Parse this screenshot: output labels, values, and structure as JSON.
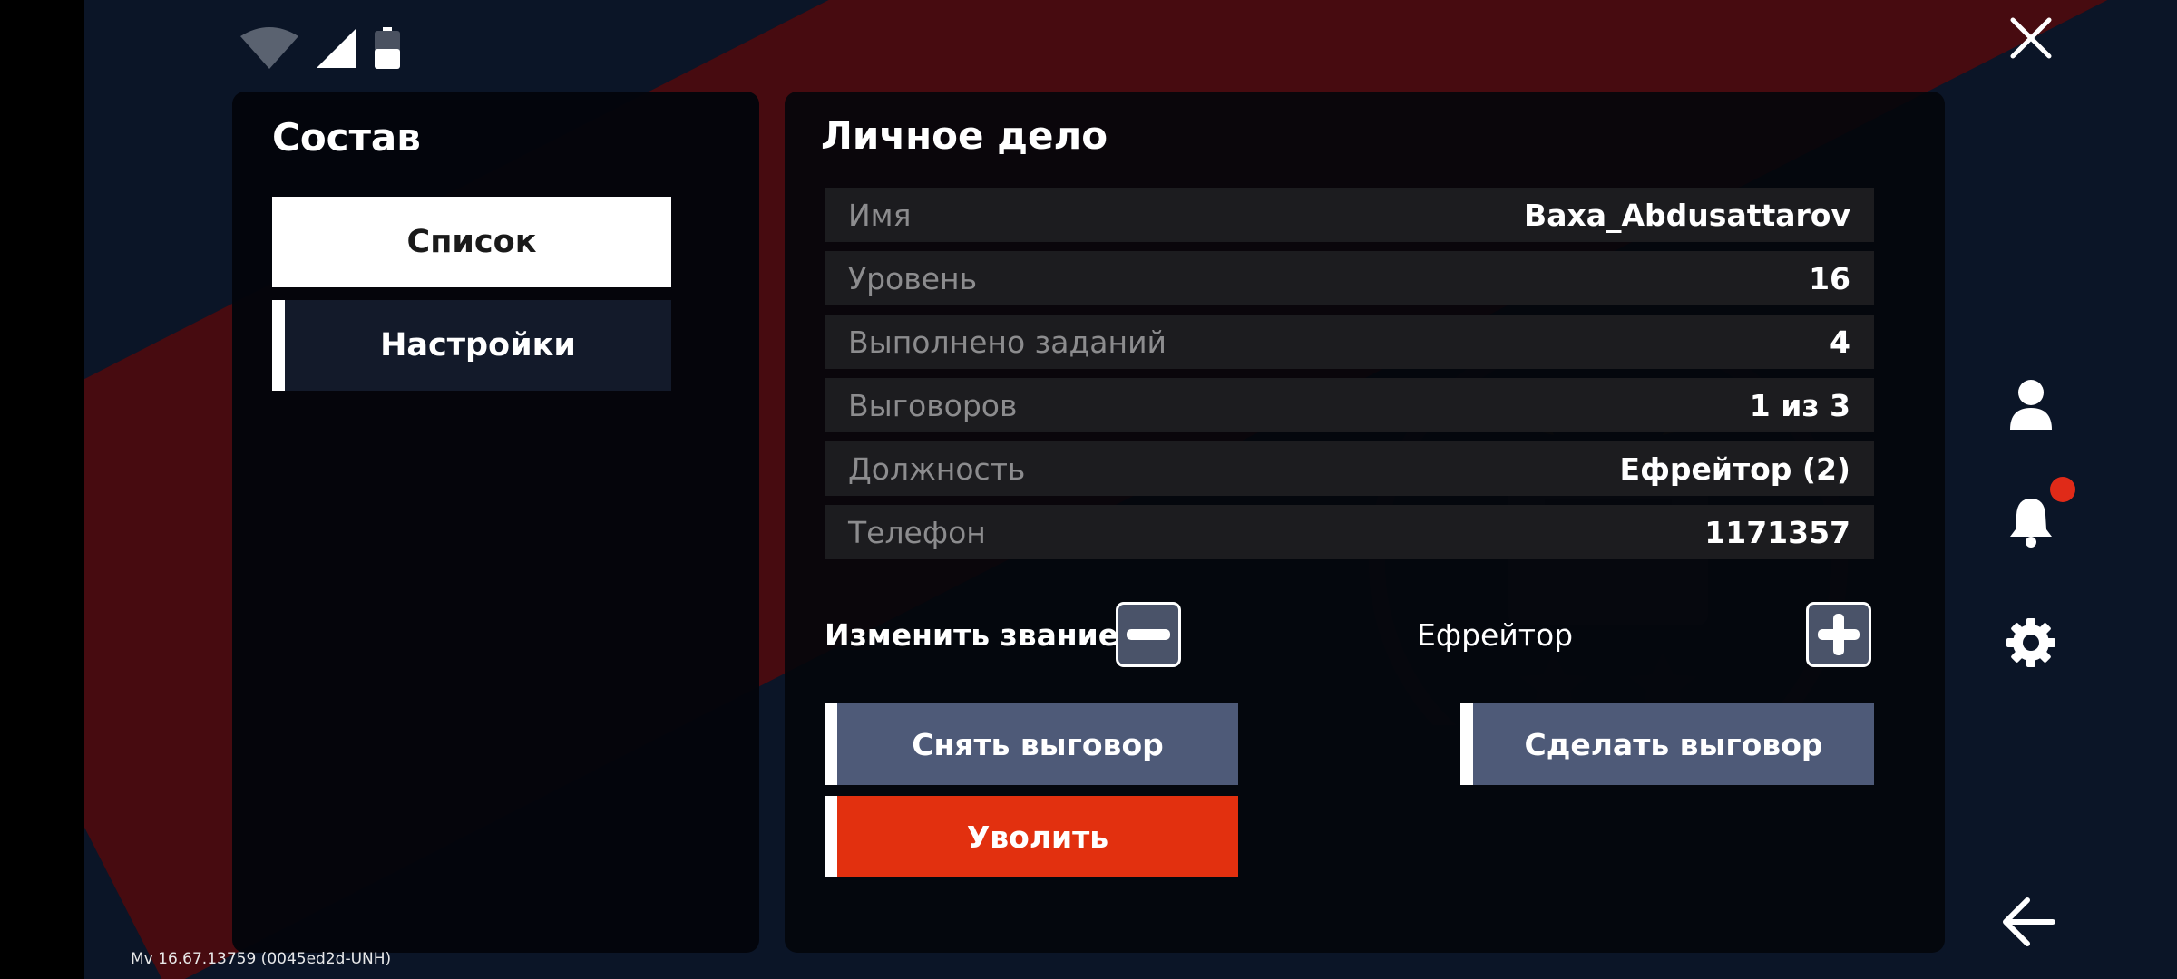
{
  "left_panel": {
    "title": "Состав",
    "nav": [
      {
        "label": "Список",
        "active": true
      },
      {
        "label": "Настройки",
        "active": false
      }
    ]
  },
  "right_panel": {
    "title": "Личное дело",
    "rows": [
      {
        "label": "Имя",
        "value": "Baxa_Abdusattarov"
      },
      {
        "label": "Уровень",
        "value": "16"
      },
      {
        "label": "Выполнено заданий",
        "value": "4"
      },
      {
        "label": "Выговоров",
        "value": "1 из 3"
      },
      {
        "label": "Должность",
        "value": "Ефрейтор (2)"
      },
      {
        "label": "Телефон",
        "value": "1171357"
      }
    ],
    "rank": {
      "label": "Изменить звание",
      "value": "Ефрейтор"
    },
    "buttons": {
      "remove_reprimand": "Снять выговор",
      "give_reprimand": "Сделать выговор",
      "fire": "Уволить"
    }
  },
  "side_icons": [
    "close-icon",
    "user-icon",
    "bell-icon",
    "gear-icon",
    "back-arrow-icon"
  ],
  "notification_dot_color": "#e02a18",
  "version": "Mv 16.67.13759 (0045ed2d-UNH)"
}
